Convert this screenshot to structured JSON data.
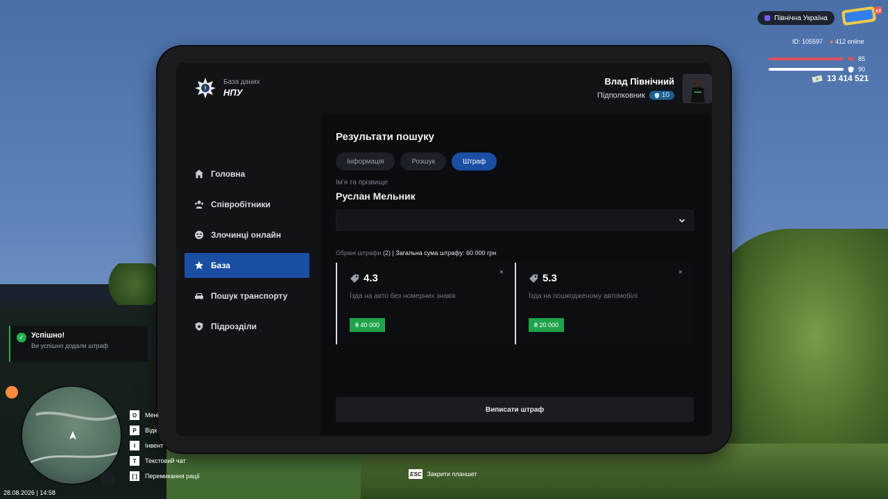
{
  "app": {
    "subtitle": "База даних",
    "name": "НПУ"
  },
  "nav": [
    {
      "label": "Головна",
      "icon": "home-icon"
    },
    {
      "label": "Співробітники",
      "icon": "people-icon"
    },
    {
      "label": "Злочинці онлайн",
      "icon": "criminal-icon"
    },
    {
      "label": "База",
      "icon": "star-icon",
      "active": true
    },
    {
      "label": "Пошук транспорту",
      "icon": "car-icon"
    },
    {
      "label": "Підрозділи",
      "icon": "shield-icon"
    }
  ],
  "user": {
    "name": "Влад Північний",
    "rank": "Підполковник",
    "level": "10"
  },
  "search": {
    "title": "Результати пошуку",
    "tabs": [
      {
        "label": "Інформація"
      },
      {
        "label": "Розшук"
      },
      {
        "label": "Штраф",
        "active": true
      }
    ],
    "name_label": "Ім'я та прізвище",
    "name_value": "Руслан Мельник",
    "summary_prefix": "Обрані штрафи",
    "summary_count": "(2)",
    "summary_total": "| Загальна сума штрафу: 60 000 грн",
    "fines": [
      {
        "code": "4.3",
        "description": "Їзда на авто без номерних знаків",
        "price": "₴ 40 000",
        "close": "×"
      },
      {
        "code": "5.3",
        "description": "Їзда на пошкодженому автомобілі",
        "price": "₴ 20 000",
        "close": "×"
      }
    ],
    "submit_label": "Виписати штраф"
  },
  "hud": {
    "region": "Північна Україна",
    "logo_badge": "x2",
    "id": "ID: 105597",
    "online": "412 online",
    "health": "85",
    "armor": "90",
    "money": "13 414 521",
    "toast_title": "Успішно!",
    "toast_text": "Ви успішно додали штраф",
    "date": "28.08.2026 | 14:58",
    "keys": [
      {
        "key": "O",
        "label": "Мені"
      },
      {
        "key": "P",
        "label": "Відк"
      },
      {
        "key": "I",
        "label": "Інвент"
      },
      {
        "key": "T",
        "label": "Текстовий чат"
      },
      {
        "key": "[ ]",
        "label": "Перемикання рації"
      }
    ],
    "esc_key": "ESC",
    "esc_label": "Закрити планшет"
  },
  "colors": {
    "accent": "#1a4ea3",
    "success": "#1fa34a",
    "health": "#e0505a",
    "armor": "#ffffff"
  }
}
